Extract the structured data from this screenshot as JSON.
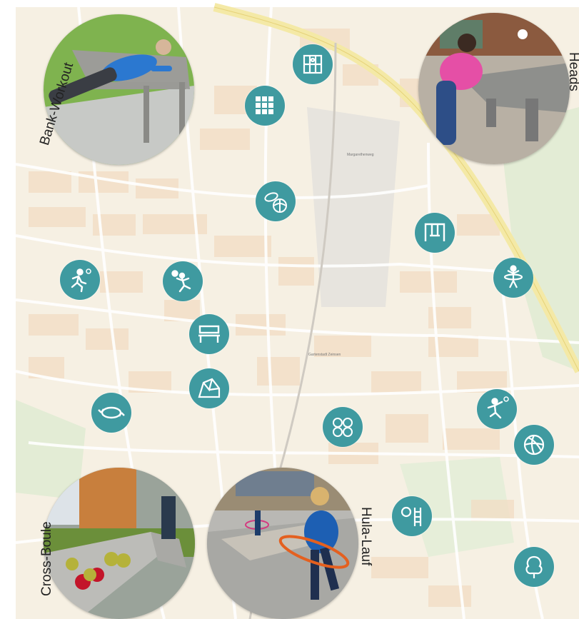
{
  "map": {
    "labels": {
      "district": "Gartenstadt Zeinsen",
      "place": "Margarethenweg"
    }
  },
  "stations": [
    {
      "icon": "climbing-ladder-icon"
    },
    {
      "icon": "climbing-wall-icon"
    },
    {
      "icon": "frisbee-and-ball-icon"
    },
    {
      "icon": "swing-icon"
    },
    {
      "icon": "hula-hoop-person-icon"
    },
    {
      "icon": "running-person-icon"
    },
    {
      "icon": "volleyball-player-icon"
    },
    {
      "icon": "bench-icon"
    },
    {
      "icon": "boulder-rock-icon"
    },
    {
      "icon": "ring-rotation-icon"
    },
    {
      "icon": "boule-balls-icon"
    },
    {
      "icon": "catching-person-icon"
    },
    {
      "icon": "volleyball-icon"
    },
    {
      "icon": "ball-and-ladder-icon"
    },
    {
      "icon": "tree-icon"
    }
  ],
  "photos": {
    "bank_workout": {
      "caption": "Bank-Workout"
    },
    "table_tennis": {
      "caption": "Heads"
    },
    "cross_boule": {
      "caption": "Cross-Boule"
    },
    "hula_lauf": {
      "caption": "Hula-Lauf"
    }
  },
  "colors": {
    "icon_circle": "#3f9aa0",
    "map_background": "#f6f0e3",
    "main_road": "#f4e9a6",
    "blocks": "#f2dcc3",
    "green_area": "#dfe9cf"
  }
}
